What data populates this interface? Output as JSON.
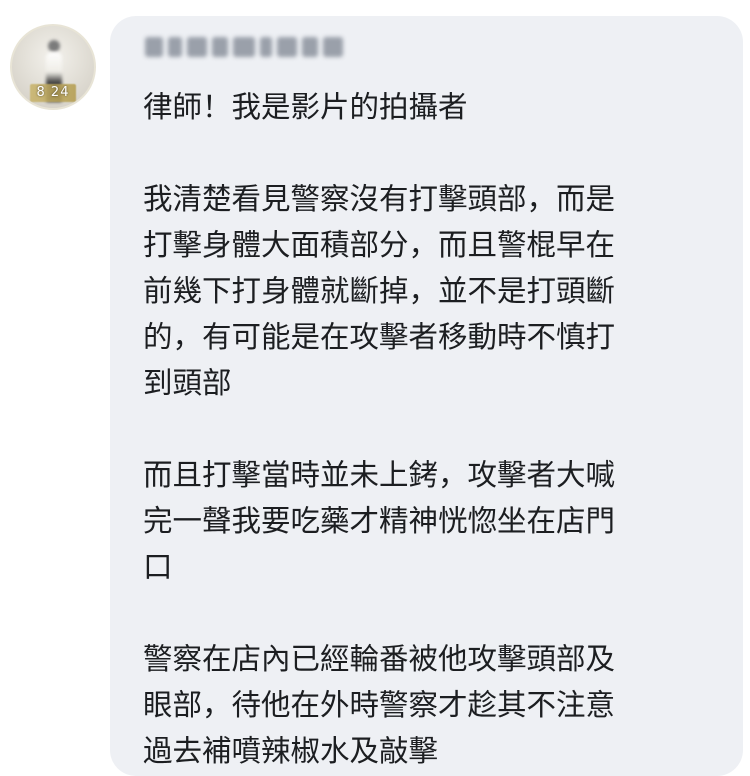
{
  "sender": {
    "name": "",
    "avatar_caption": "8 24"
  },
  "message": {
    "lines": [
      "律師！我是影片的拍攝者",
      "",
      "我清楚看見警察沒有打擊頭部，而是",
      "打擊身體大面積部分，而且警棍早在",
      "前幾下打身體就斷掉，並不是打頭斷",
      "的，有可能是在攻擊者移動時不慎打",
      "到頭部",
      "",
      "而且打擊當時並未上銬，攻擊者大喊",
      "完一聲我要吃藥才精神恍惚坐在店門",
      "口",
      "",
      "警察在店內已經輪番被他攻擊頭部及",
      "眼部，待他在外時警察才趁其不注意",
      "過去補噴辣椒水及敲擊"
    ]
  },
  "colors": {
    "bubble_bg": "#eef0f4",
    "text": "#1c1e21"
  }
}
